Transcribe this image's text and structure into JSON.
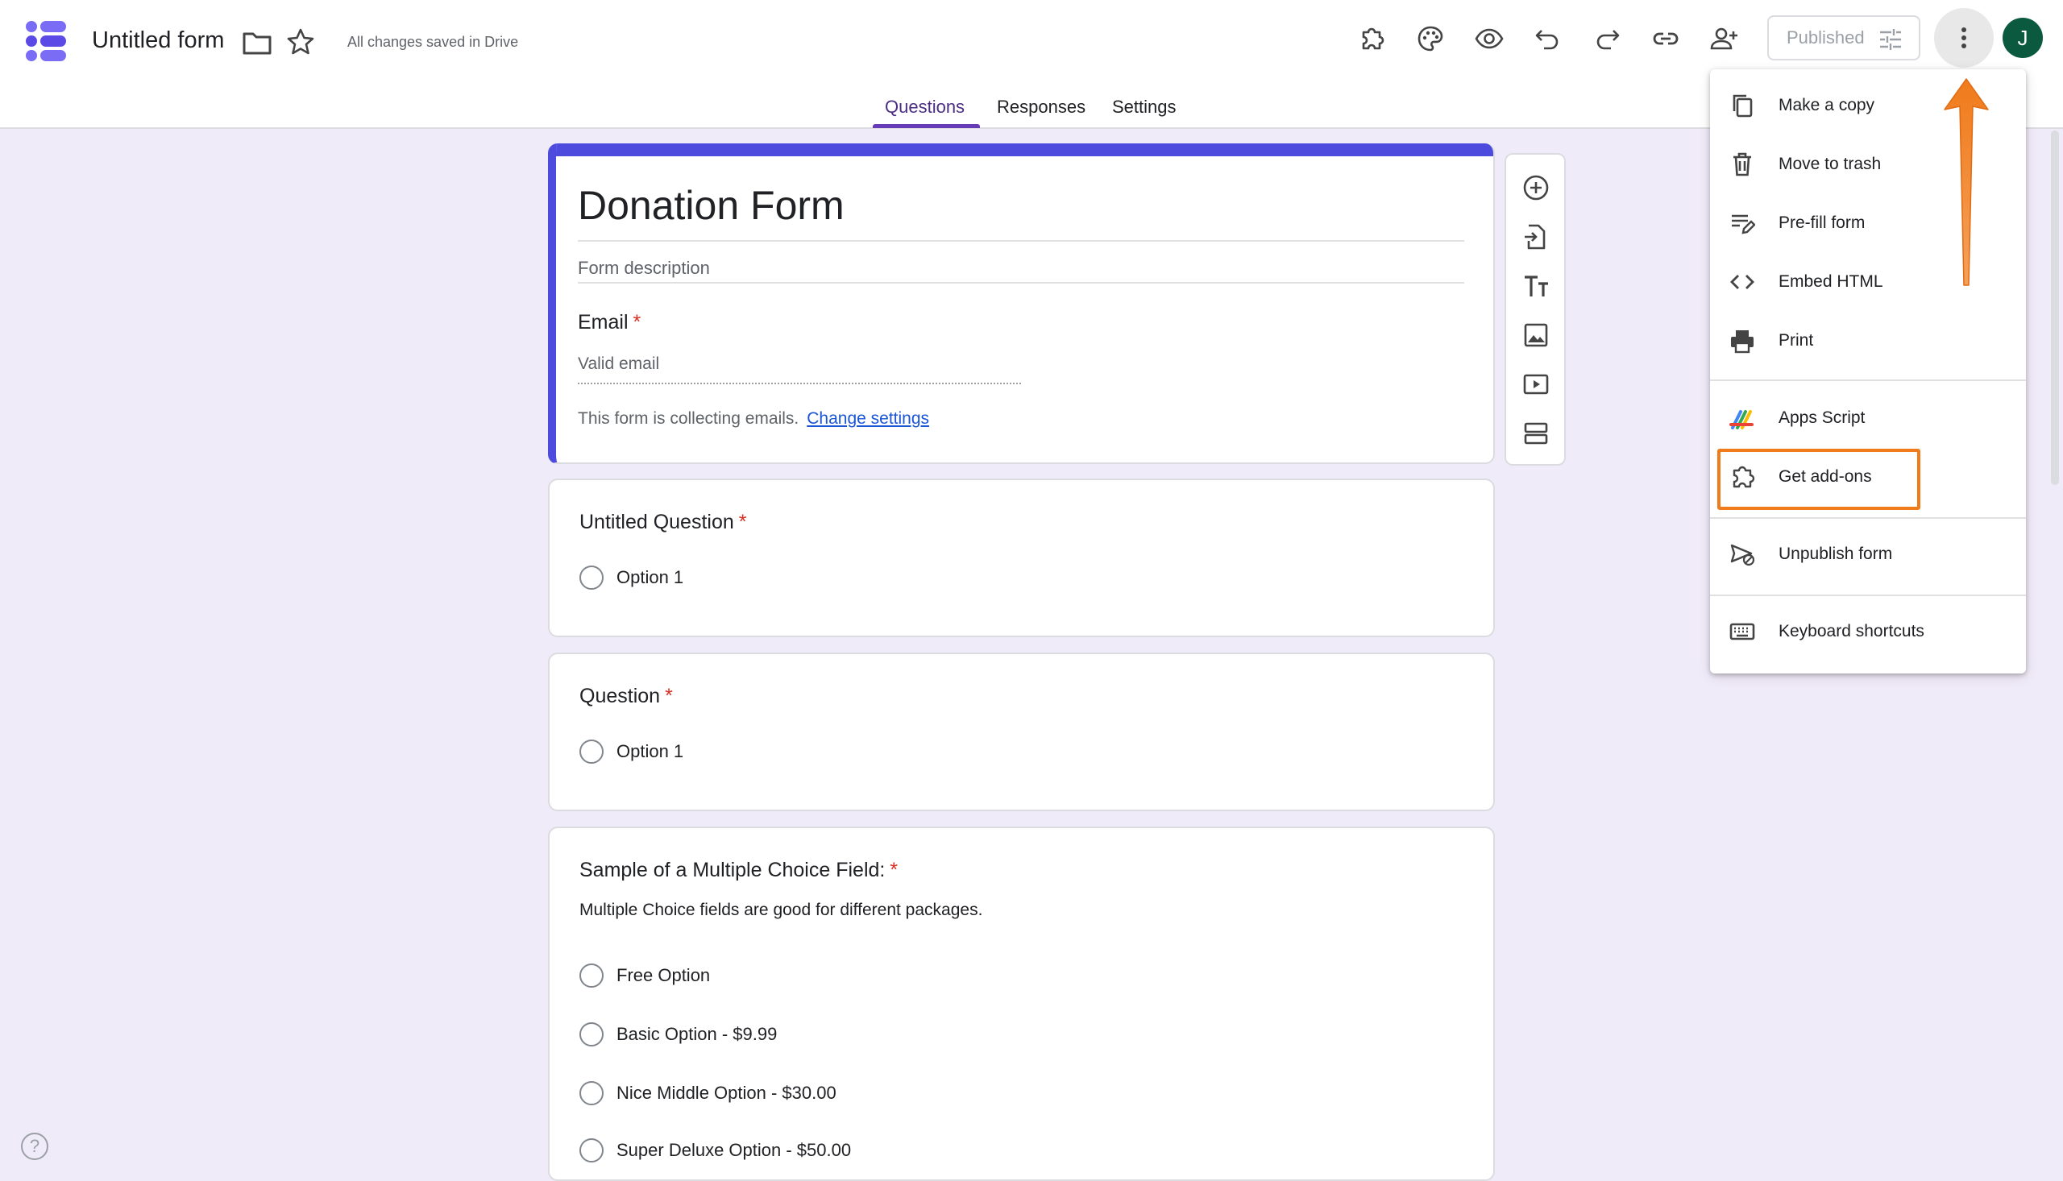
{
  "header": {
    "title": "Untitled form",
    "save_status": "All changes saved in Drive",
    "publish_label": "Published",
    "avatar_initial": "J"
  },
  "tabs": [
    {
      "label": "Questions",
      "active": true
    },
    {
      "label": "Responses",
      "active": false
    },
    {
      "label": "Settings",
      "active": false
    }
  ],
  "form": {
    "title": "Donation Form",
    "description_placeholder": "Form description",
    "email_label": "Email",
    "email_placeholder": "Valid email",
    "collecting_text": "This form is collecting emails.",
    "change_settings_link": "Change settings",
    "required_mark": "*"
  },
  "questions": [
    {
      "title": "Untitled Question",
      "options": [
        "Option 1"
      ]
    },
    {
      "title": "Question",
      "options": [
        "Option 1"
      ]
    },
    {
      "title": "Sample of a Multiple Choice Field:",
      "description": "Multiple Choice fields are good for different packages.",
      "options": [
        "Free Option",
        "Basic Option - $9.99",
        "Nice Middle Option - $30.00",
        "Super Deluxe Option - $50.00"
      ]
    }
  ],
  "menu": {
    "items": [
      {
        "label": "Make a copy",
        "icon": "copy-icon"
      },
      {
        "label": "Move to trash",
        "icon": "trash-icon"
      },
      {
        "label": "Pre-fill form",
        "icon": "prefill-icon"
      },
      {
        "label": "Embed HTML",
        "icon": "code-icon"
      },
      {
        "label": "Print",
        "icon": "print-icon"
      },
      {
        "label": "Apps Script",
        "icon": "apps-script-icon"
      },
      {
        "label": "Get add-ons",
        "icon": "puzzle-icon",
        "highlighted": true
      },
      {
        "label": "Unpublish form",
        "icon": "unpublish-icon"
      },
      {
        "label": "Keyboard shortcuts",
        "icon": "keyboard-icon"
      }
    ]
  },
  "colors": {
    "accent": "#673ab7",
    "form_header": "#4c4bde",
    "highlight": "#f07b1b",
    "background": "#f0ebf8"
  }
}
